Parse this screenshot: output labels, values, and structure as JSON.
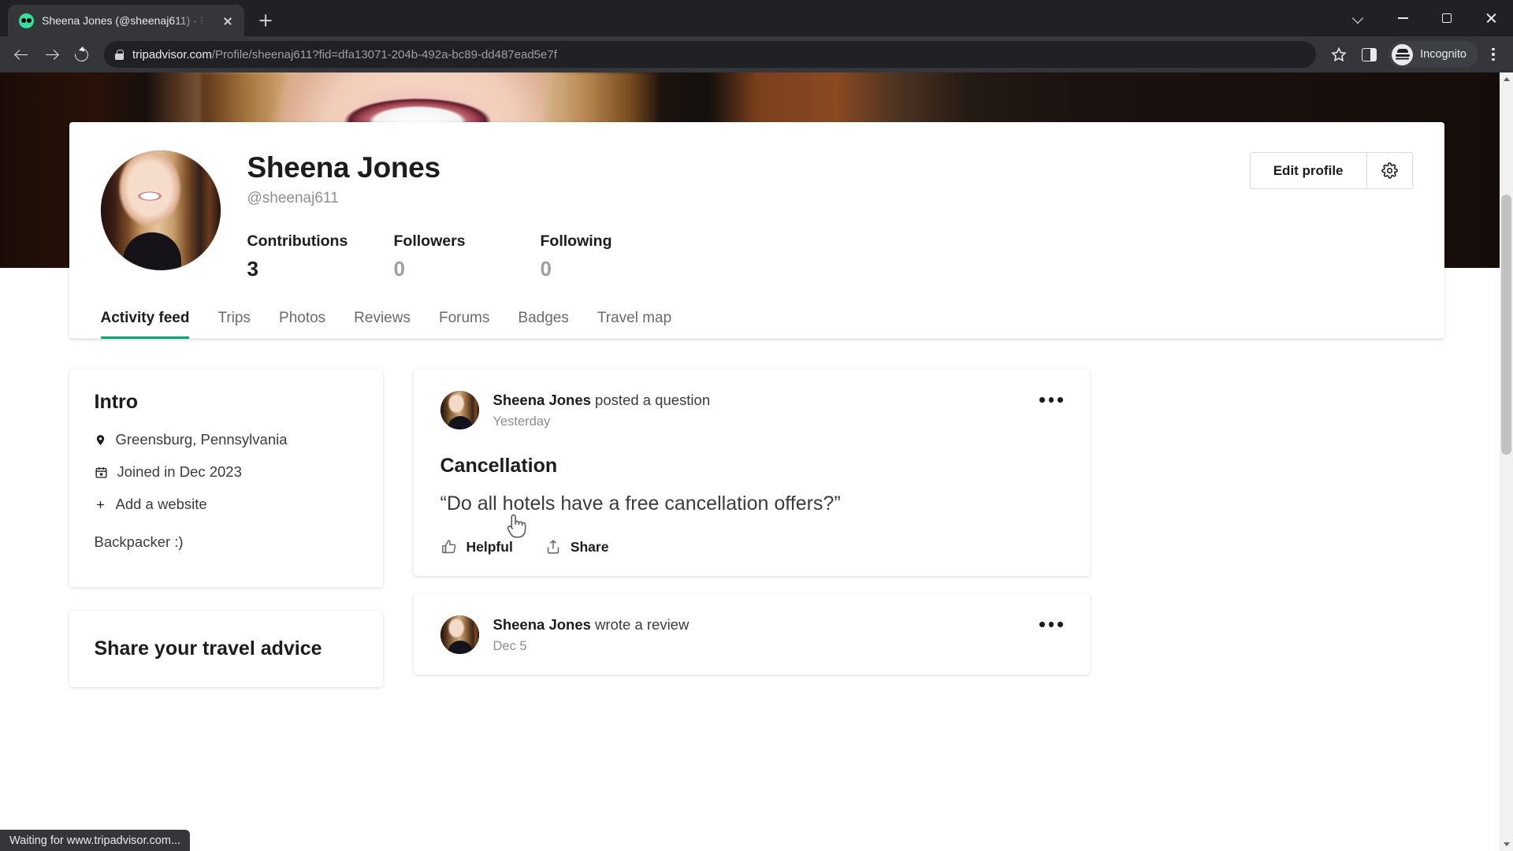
{
  "browser": {
    "tab": {
      "title": "Sheena Jones (@sheenaj611) - P",
      "favicon_icon": "tripadvisor-owl-icon",
      "close_icon": "close-icon"
    },
    "new_tab_icon": "plus-icon",
    "window_controls": {
      "more_icon": "chevron-down-icon",
      "minimize_icon": "minimize-icon",
      "maximize_icon": "maximize-icon",
      "close_icon": "close-icon"
    },
    "nav": {
      "back_icon": "back-arrow-icon",
      "forward_icon": "forward-arrow-icon",
      "reload_icon": "reload-icon"
    },
    "omnibox": {
      "lock_icon": "lock-icon",
      "url_host": "tripadvisor.com",
      "url_path": "/Profile/sheenaj611?fid=dfa13071-204b-492a-bc89-dd487ead5e7f"
    },
    "bookmark_icon": "star-icon",
    "side_panel_icon": "side-panel-icon",
    "incognito": {
      "avatar_icon": "incognito-hat-icon",
      "label": "Incognito"
    },
    "menu_icon": "kebab-menu-icon",
    "status_text": "Waiting for www.tripadvisor.com..."
  },
  "profile": {
    "name": "Sheena Jones",
    "handle": "@sheenaj611",
    "avatar_icon": "user-avatar",
    "cover_photo_icon": "cover-photo",
    "actions": {
      "edit_label": "Edit profile",
      "settings_icon": "gear-icon"
    },
    "stats": [
      {
        "label": "Contributions",
        "value": "3",
        "muted": false
      },
      {
        "label": "Followers",
        "value": "0",
        "muted": true
      },
      {
        "label": "Following",
        "value": "0",
        "muted": true
      }
    ],
    "tabs": [
      {
        "label": "Activity feed",
        "active": true
      },
      {
        "label": "Trips",
        "active": false
      },
      {
        "label": "Photos",
        "active": false
      },
      {
        "label": "Reviews",
        "active": false
      },
      {
        "label": "Forums",
        "active": false
      },
      {
        "label": "Badges",
        "active": false
      },
      {
        "label": "Travel map",
        "active": false
      }
    ]
  },
  "intro": {
    "title": "Intro",
    "location_icon": "map-pin-icon",
    "location": "Greensburg, Pennsylvania",
    "joined_icon": "calendar-icon",
    "joined": "Joined in Dec 2023",
    "add_website_icon": "plus-icon",
    "add_website": "Add a website",
    "bio": "Backpacker :)"
  },
  "advice": {
    "title": "Share your travel advice"
  },
  "feed": [
    {
      "avatar_icon": "user-avatar",
      "actor": "Sheena Jones",
      "action": " posted a question",
      "time": "Yesterday",
      "more_icon": "more-options-icon",
      "title": "Cancellation",
      "quote": "“Do all hotels have a free cancellation offers?”",
      "actions": [
        {
          "label": "Helpful",
          "icon": "thumbs-up-icon"
        },
        {
          "label": "Share",
          "icon": "share-icon"
        }
      ]
    },
    {
      "avatar_icon": "user-avatar",
      "actor": "Sheena Jones",
      "action": " wrote a review",
      "time": "Dec 5",
      "more_icon": "more-options-icon"
    }
  ],
  "colors": {
    "accent_green": "#00aa6c",
    "text_dark": "#1c1c1c",
    "text_muted": "#8e8e8e",
    "chrome_dark": "#35363a"
  },
  "cursor": {
    "icon": "pointer-hand-cursor"
  }
}
